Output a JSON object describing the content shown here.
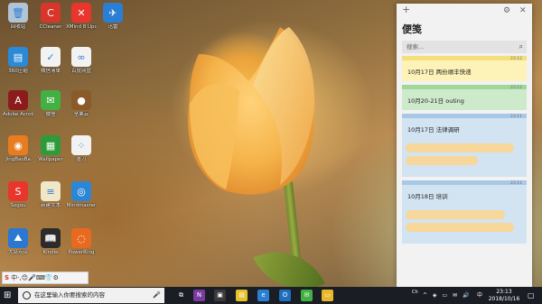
{
  "desktop": {
    "icons": [
      {
        "label": "回收站",
        "icon": "recycle-bin-icon",
        "color": "#b0c4d8",
        "glyph": "🗑"
      },
      {
        "label": "CCleaner",
        "icon": "ccleaner-icon",
        "color": "#d9362b",
        "glyph": "C"
      },
      {
        "label": "XMind 8 Update 7",
        "icon": "xmind-icon",
        "color": "#e8362c",
        "glyph": "✕"
      },
      {
        "label": "迅雷",
        "icon": "thunder-icon",
        "color": "#2a7fd4",
        "glyph": "✈"
      },
      {
        "label": "360压缩",
        "icon": "360zip-icon",
        "color": "#2a8ad8",
        "glyph": "▤"
      },
      {
        "label": "微信清单",
        "icon": "todo-icon",
        "color": "#f2f2f2",
        "glyph": "✓"
      },
      {
        "label": "百度网盘",
        "icon": "baidu-pan-icon",
        "color": "#f2f2f2",
        "glyph": "∞"
      },
      {
        "label": "Adobe Acrobat DC",
        "icon": "acrobat-icon",
        "color": "#8c1c1c",
        "glyph": "A"
      },
      {
        "label": "微信",
        "icon": "wechat-icon",
        "color": "#43b044",
        "glyph": "✉"
      },
      {
        "label": "坚果云",
        "icon": "nutstore-icon",
        "color": "#8a5a2b",
        "glyph": "●"
      },
      {
        "label": "JingBaoBa",
        "icon": "jingbaoba-icon",
        "color": "#e87c20",
        "glyph": "◉"
      },
      {
        "label": "Wallpaper",
        "icon": "wallpaper-icon",
        "color": "#2e9b3a",
        "glyph": "▦"
      },
      {
        "label": "墨刀",
        "icon": "modao-icon",
        "color": "#f2f2f2",
        "glyph": "⁘"
      },
      {
        "label": "Sogou",
        "icon": "sogou-icon",
        "color": "#e8362c",
        "glyph": "S"
      },
      {
        "label": "新建文本",
        "icon": "text-file-icon",
        "color": "#f0e6c8",
        "glyph": "≡"
      },
      {
        "label": "Mindmaster",
        "icon": "mindmaster-icon",
        "color": "#2b87d6",
        "glyph": "◎"
      },
      {
        "label": "大众点评",
        "icon": "dianping-icon",
        "color": "#2a78d2",
        "glyph": "⛰"
      },
      {
        "label": "Kindle",
        "icon": "kindle-icon",
        "color": "#2b2b2b",
        "glyph": "📖"
      },
      {
        "label": "PowerRing",
        "icon": "powerring-icon",
        "color": "#e86a20",
        "glyph": "◌"
      }
    ]
  },
  "ime": {
    "text": "中·,😊🎤⌨👕⚙"
  },
  "notes": {
    "title": "便笺",
    "add_label": "+",
    "settings_label": "⚙",
    "close_label": "✕",
    "search_placeholder": "搜索...",
    "search_icon": "search-icon",
    "items": [
      {
        "text": "10月17日 两份顺丰快递",
        "time": "23:12",
        "color": "#fdf2b8",
        "bar": "#f5df7a"
      },
      {
        "text": "10月20-21日 outing",
        "time": "23:12",
        "color": "#cdeacb",
        "bar": "#9fd89a"
      },
      {
        "text": "10月17日 法律调研",
        "time": "23:11",
        "color": "#d2e3f2",
        "bar": "#a8c8e8"
      },
      {
        "text": "10月18日 培训",
        "time": "23:11",
        "color": "#d2e3f2",
        "bar": "#a8c8e8"
      }
    ]
  },
  "taskbar": {
    "search_placeholder": "在这里输入你要搜索的内容",
    "apps": [
      {
        "name": "task-view-icon",
        "glyph": "⧉",
        "color": "#1a1d24"
      },
      {
        "name": "onenote-icon",
        "glyph": "N",
        "color": "#7a3aa0"
      },
      {
        "name": "tablet-icon",
        "glyph": "▣",
        "color": "#3a3a3a"
      },
      {
        "name": "sticky-notes-icon",
        "glyph": "▤",
        "color": "#e8c22a"
      },
      {
        "name": "edge-icon",
        "glyph": "e",
        "color": "#2a7fd4"
      },
      {
        "name": "outlook-icon",
        "glyph": "O",
        "color": "#1f6ebd"
      },
      {
        "name": "wechat-taskbar-icon",
        "glyph": "✉",
        "color": "#43b044"
      },
      {
        "name": "file-explorer-icon",
        "glyph": "▭",
        "color": "#e8b82a"
      }
    ],
    "tray_text": "Ch",
    "tray_icons": "^ ◈ ▭ ✉ 🔊",
    "ime_lang": "中",
    "time": "23:13",
    "date": "2018/10/16"
  }
}
